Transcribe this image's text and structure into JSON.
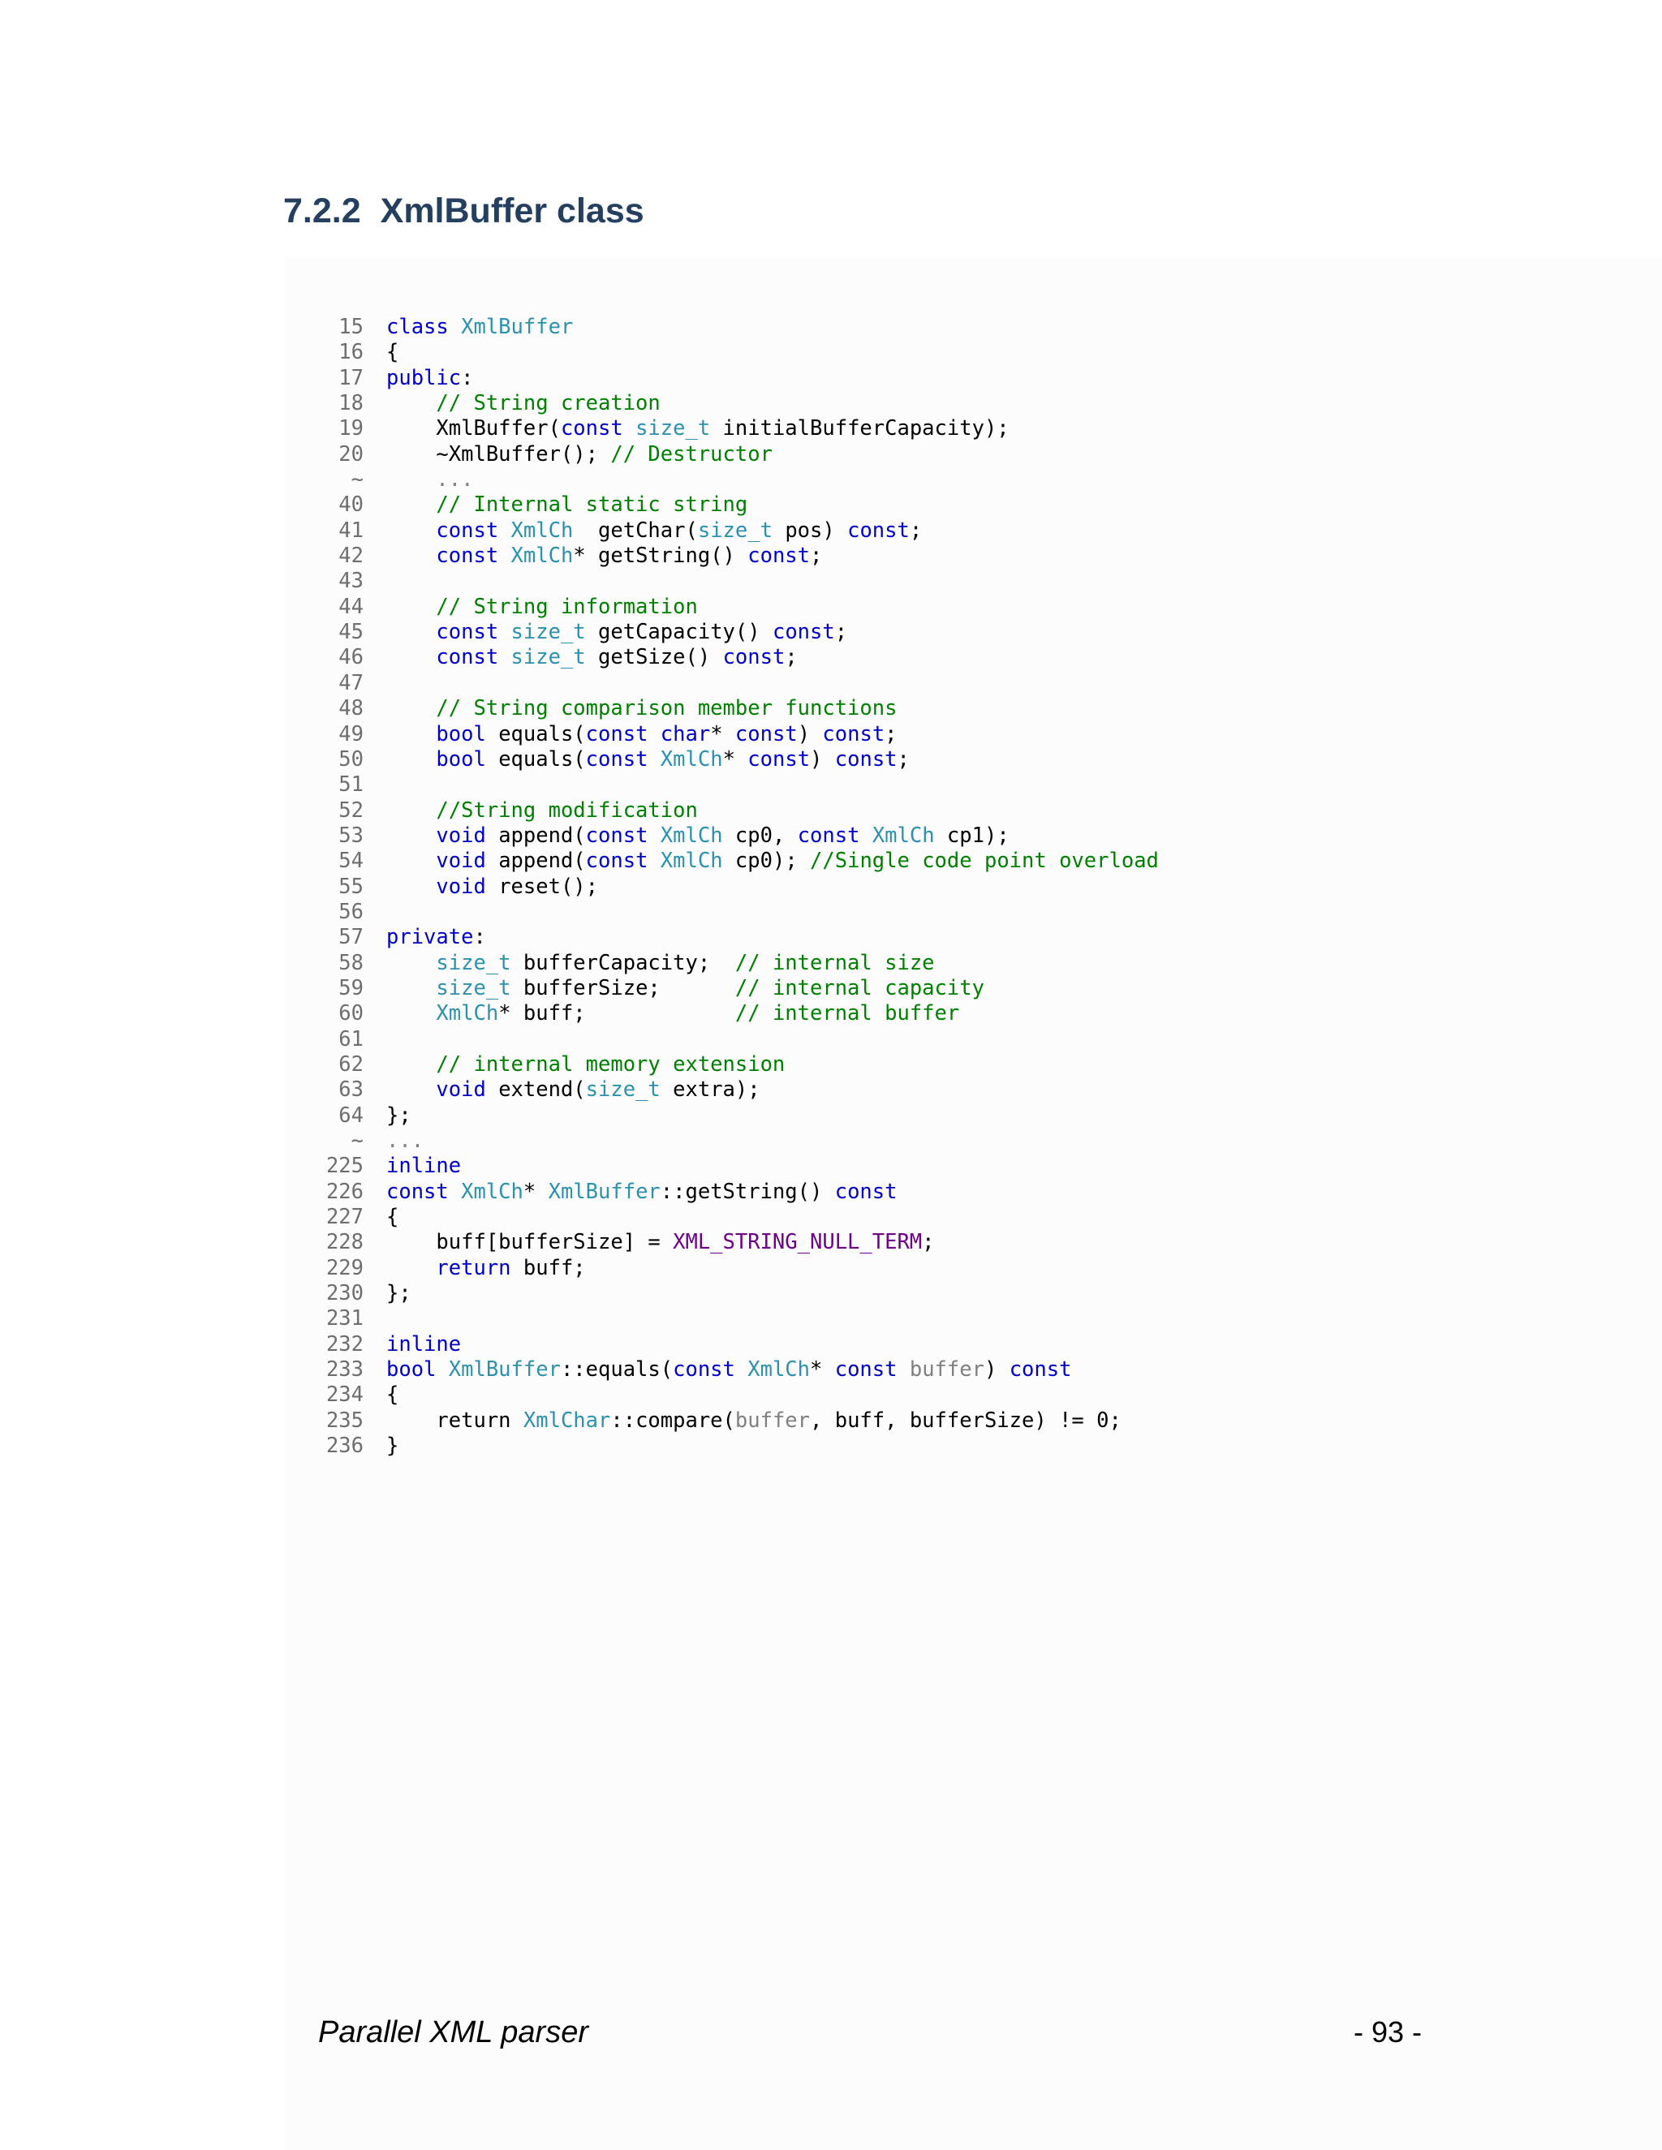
{
  "section": {
    "number": "7.2.2",
    "title": "XmlBuffer class"
  },
  "code": {
    "lines": [
      {
        "n": "15",
        "tokens": [
          {
            "t": "class ",
            "c": "kw"
          },
          {
            "t": "XmlBuffer",
            "c": "ty"
          }
        ]
      },
      {
        "n": "16",
        "tokens": [
          {
            "t": "{",
            "c": ""
          }
        ]
      },
      {
        "n": "17",
        "tokens": [
          {
            "t": "public",
            "c": "kw"
          },
          {
            "t": ":",
            "c": ""
          }
        ]
      },
      {
        "n": "18",
        "tokens": [
          {
            "t": "    ",
            "c": ""
          },
          {
            "t": "// String creation",
            "c": "cm"
          }
        ]
      },
      {
        "n": "19",
        "tokens": [
          {
            "t": "    XmlBuffer(",
            "c": ""
          },
          {
            "t": "const ",
            "c": "kw"
          },
          {
            "t": "size_t",
            "c": "ty"
          },
          {
            "t": " initialBufferCapacity);",
            "c": ""
          }
        ]
      },
      {
        "n": "20",
        "tokens": [
          {
            "t": "    ~XmlBuffer(); ",
            "c": ""
          },
          {
            "t": "// Destructor",
            "c": "cm"
          }
        ]
      },
      {
        "n": "~",
        "tokens": [
          {
            "t": "    ",
            "c": ""
          },
          {
            "t": "...",
            "c": "el"
          }
        ]
      },
      {
        "n": "40",
        "tokens": [
          {
            "t": "    ",
            "c": ""
          },
          {
            "t": "// Internal static string",
            "c": "cm"
          }
        ]
      },
      {
        "n": "41",
        "tokens": [
          {
            "t": "    ",
            "c": ""
          },
          {
            "t": "const ",
            "c": "kw"
          },
          {
            "t": "XmlCh",
            "c": "ty"
          },
          {
            "t": "  getChar(",
            "c": ""
          },
          {
            "t": "size_t",
            "c": "ty"
          },
          {
            "t": " pos) ",
            "c": ""
          },
          {
            "t": "const",
            "c": "kw"
          },
          {
            "t": ";",
            "c": ""
          }
        ]
      },
      {
        "n": "42",
        "tokens": [
          {
            "t": "    ",
            "c": ""
          },
          {
            "t": "const ",
            "c": "kw"
          },
          {
            "t": "XmlCh",
            "c": "ty"
          },
          {
            "t": "* getString() ",
            "c": ""
          },
          {
            "t": "const",
            "c": "kw"
          },
          {
            "t": ";",
            "c": ""
          }
        ]
      },
      {
        "n": "43",
        "tokens": []
      },
      {
        "n": "44",
        "tokens": [
          {
            "t": "    ",
            "c": ""
          },
          {
            "t": "// String information",
            "c": "cm"
          }
        ]
      },
      {
        "n": "45",
        "tokens": [
          {
            "t": "    ",
            "c": ""
          },
          {
            "t": "const ",
            "c": "kw"
          },
          {
            "t": "size_t",
            "c": "ty"
          },
          {
            "t": " getCapacity() ",
            "c": ""
          },
          {
            "t": "const",
            "c": "kw"
          },
          {
            "t": ";",
            "c": ""
          }
        ]
      },
      {
        "n": "46",
        "tokens": [
          {
            "t": "    ",
            "c": ""
          },
          {
            "t": "const ",
            "c": "kw"
          },
          {
            "t": "size_t",
            "c": "ty"
          },
          {
            "t": " getSize() ",
            "c": ""
          },
          {
            "t": "const",
            "c": "kw"
          },
          {
            "t": ";",
            "c": ""
          }
        ]
      },
      {
        "n": "47",
        "tokens": []
      },
      {
        "n": "48",
        "tokens": [
          {
            "t": "    ",
            "c": ""
          },
          {
            "t": "// String comparison member functions",
            "c": "cm"
          }
        ]
      },
      {
        "n": "49",
        "tokens": [
          {
            "t": "    ",
            "c": ""
          },
          {
            "t": "bool",
            "c": "kw"
          },
          {
            "t": " equals(",
            "c": ""
          },
          {
            "t": "const char",
            "c": "kw"
          },
          {
            "t": "* ",
            "c": ""
          },
          {
            "t": "const",
            "c": "kw"
          },
          {
            "t": ") ",
            "c": ""
          },
          {
            "t": "const",
            "c": "kw"
          },
          {
            "t": ";",
            "c": ""
          }
        ]
      },
      {
        "n": "50",
        "tokens": [
          {
            "t": "    ",
            "c": ""
          },
          {
            "t": "bool",
            "c": "kw"
          },
          {
            "t": " equals(",
            "c": ""
          },
          {
            "t": "const ",
            "c": "kw"
          },
          {
            "t": "XmlCh",
            "c": "ty"
          },
          {
            "t": "* ",
            "c": ""
          },
          {
            "t": "const",
            "c": "kw"
          },
          {
            "t": ") ",
            "c": ""
          },
          {
            "t": "const",
            "c": "kw"
          },
          {
            "t": ";",
            "c": ""
          }
        ]
      },
      {
        "n": "51",
        "tokens": []
      },
      {
        "n": "52",
        "tokens": [
          {
            "t": "    ",
            "c": ""
          },
          {
            "t": "//String modification",
            "c": "cm"
          }
        ]
      },
      {
        "n": "53",
        "tokens": [
          {
            "t": "    ",
            "c": ""
          },
          {
            "t": "void",
            "c": "kw"
          },
          {
            "t": " append(",
            "c": ""
          },
          {
            "t": "const ",
            "c": "kw"
          },
          {
            "t": "XmlCh",
            "c": "ty"
          },
          {
            "t": " cp0, ",
            "c": ""
          },
          {
            "t": "const ",
            "c": "kw"
          },
          {
            "t": "XmlCh",
            "c": "ty"
          },
          {
            "t": " cp1);",
            "c": ""
          }
        ]
      },
      {
        "n": "54",
        "tokens": [
          {
            "t": "    ",
            "c": ""
          },
          {
            "t": "void",
            "c": "kw"
          },
          {
            "t": " append(",
            "c": ""
          },
          {
            "t": "const ",
            "c": "kw"
          },
          {
            "t": "XmlCh",
            "c": "ty"
          },
          {
            "t": " cp0); ",
            "c": ""
          },
          {
            "t": "//Single code point overload",
            "c": "cm"
          }
        ]
      },
      {
        "n": "55",
        "tokens": [
          {
            "t": "    ",
            "c": ""
          },
          {
            "t": "void",
            "c": "kw"
          },
          {
            "t": " reset();",
            "c": ""
          }
        ]
      },
      {
        "n": "56",
        "tokens": []
      },
      {
        "n": "57",
        "tokens": [
          {
            "t": "private",
            "c": "kw"
          },
          {
            "t": ":",
            "c": ""
          }
        ]
      },
      {
        "n": "58",
        "tokens": [
          {
            "t": "    ",
            "c": ""
          },
          {
            "t": "size_t",
            "c": "ty"
          },
          {
            "t": " bufferCapacity;  ",
            "c": ""
          },
          {
            "t": "// internal size",
            "c": "cm"
          }
        ]
      },
      {
        "n": "59",
        "tokens": [
          {
            "t": "    ",
            "c": ""
          },
          {
            "t": "size_t",
            "c": "ty"
          },
          {
            "t": " bufferSize;      ",
            "c": ""
          },
          {
            "t": "// internal capacity",
            "c": "cm"
          }
        ]
      },
      {
        "n": "60",
        "tokens": [
          {
            "t": "    ",
            "c": ""
          },
          {
            "t": "XmlCh",
            "c": "ty"
          },
          {
            "t": "* buff;            ",
            "c": ""
          },
          {
            "t": "// internal buffer",
            "c": "cm"
          }
        ]
      },
      {
        "n": "61",
        "tokens": []
      },
      {
        "n": "62",
        "tokens": [
          {
            "t": "    ",
            "c": ""
          },
          {
            "t": "// internal memory extension",
            "c": "cm"
          }
        ]
      },
      {
        "n": "63",
        "tokens": [
          {
            "t": "    ",
            "c": ""
          },
          {
            "t": "void",
            "c": "kw"
          },
          {
            "t": " extend(",
            "c": ""
          },
          {
            "t": "size_t",
            "c": "ty"
          },
          {
            "t": " extra);",
            "c": ""
          }
        ]
      },
      {
        "n": "64",
        "tokens": [
          {
            "t": "};",
            "c": ""
          }
        ]
      },
      {
        "n": "~",
        "tokens": [
          {
            "t": "...",
            "c": "el"
          }
        ]
      },
      {
        "n": "225",
        "tokens": [
          {
            "t": "inline",
            "c": "kw"
          }
        ]
      },
      {
        "n": "226",
        "tokens": [
          {
            "t": "const ",
            "c": "kw"
          },
          {
            "t": "XmlCh",
            "c": "ty"
          },
          {
            "t": "* ",
            "c": ""
          },
          {
            "t": "XmlBuffer",
            "c": "ty"
          },
          {
            "t": "::getString() ",
            "c": ""
          },
          {
            "t": "const",
            "c": "kw"
          }
        ]
      },
      {
        "n": "227",
        "tokens": [
          {
            "t": "{",
            "c": ""
          }
        ]
      },
      {
        "n": "228",
        "tokens": [
          {
            "t": "    buff[bufferSize] = ",
            "c": ""
          },
          {
            "t": "XML_STRING_NULL_TERM",
            "c": "mc"
          },
          {
            "t": ";",
            "c": ""
          }
        ]
      },
      {
        "n": "229",
        "tokens": [
          {
            "t": "    ",
            "c": ""
          },
          {
            "t": "return",
            "c": "kw"
          },
          {
            "t": " buff;",
            "c": ""
          }
        ]
      },
      {
        "n": "230",
        "tokens": [
          {
            "t": "};",
            "c": ""
          }
        ]
      },
      {
        "n": "231",
        "tokens": []
      },
      {
        "n": "232",
        "tokens": [
          {
            "t": "inline",
            "c": "kw"
          }
        ]
      },
      {
        "n": "233",
        "tokens": [
          {
            "t": "bool ",
            "c": "kw"
          },
          {
            "t": "XmlBuffer",
            "c": "ty"
          },
          {
            "t": "::equals(",
            "c": ""
          },
          {
            "t": "const ",
            "c": "kw"
          },
          {
            "t": "XmlCh",
            "c": "ty"
          },
          {
            "t": "* ",
            "c": ""
          },
          {
            "t": "const ",
            "c": "kw"
          },
          {
            "t": "buffer",
            "c": "pm"
          },
          {
            "t": ") ",
            "c": ""
          },
          {
            "t": "const",
            "c": "kw"
          }
        ]
      },
      {
        "n": "234",
        "tokens": [
          {
            "t": "{",
            "c": ""
          }
        ]
      },
      {
        "n": "235",
        "tokens": [
          {
            "t": "    return ",
            "c": ""
          },
          {
            "t": "XmlChar",
            "c": "ty"
          },
          {
            "t": "::compare(",
            "c": ""
          },
          {
            "t": "buffer",
            "c": "pm"
          },
          {
            "t": ", buff, bufferSize) != 0;",
            "c": ""
          }
        ]
      },
      {
        "n": "236",
        "tokens": [
          {
            "t": "}",
            "c": ""
          }
        ]
      }
    ]
  },
  "footer": {
    "title": "Parallel XML parser",
    "page": "- 93 -"
  }
}
